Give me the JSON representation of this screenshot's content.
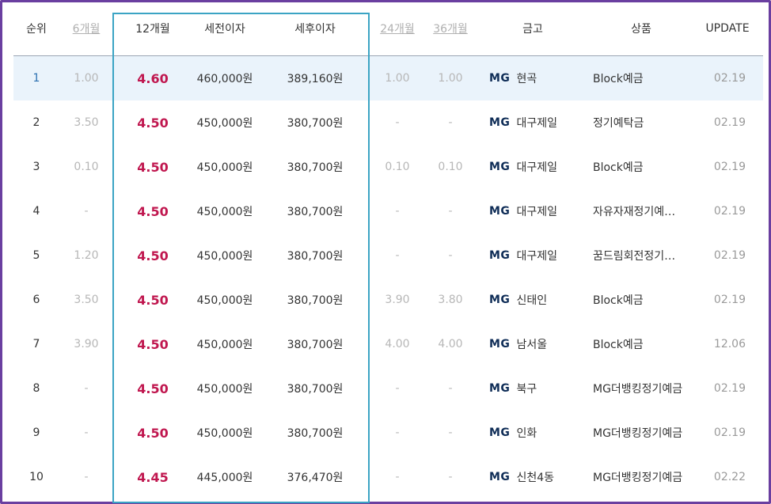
{
  "header": {
    "rank": "순위",
    "m6": "6개월",
    "m12": "12개월",
    "pretax": "세전이자",
    "posttax": "세후이자",
    "m24": "24개월",
    "m36": "36개월",
    "bank": "금고",
    "product": "상품",
    "update": "UPDATE"
  },
  "colors": {
    "frame": "#6a3fa0",
    "highlight_box": "#3ba4c4",
    "rate": "#c0174f",
    "first_row_bg": "#eaf3fb",
    "brand": "#0f2d57"
  },
  "brand_prefix": "MG",
  "rows": [
    {
      "rank": "1",
      "m6": "1.00",
      "m12": "4.60",
      "pretax": "460,000원",
      "posttax": "389,160원",
      "m24": "1.00",
      "m36": "1.00",
      "bank": "현곡",
      "product": "Block예금",
      "update": "02.19"
    },
    {
      "rank": "2",
      "m6": "3.50",
      "m12": "4.50",
      "pretax": "450,000원",
      "posttax": "380,700원",
      "m24": "-",
      "m36": "-",
      "bank": "대구제일",
      "product": "정기예탁금",
      "update": "02.19"
    },
    {
      "rank": "3",
      "m6": "0.10",
      "m12": "4.50",
      "pretax": "450,000원",
      "posttax": "380,700원",
      "m24": "0.10",
      "m36": "0.10",
      "bank": "대구제일",
      "product": "Block예금",
      "update": "02.19"
    },
    {
      "rank": "4",
      "m6": "-",
      "m12": "4.50",
      "pretax": "450,000원",
      "posttax": "380,700원",
      "m24": "-",
      "m36": "-",
      "bank": "대구제일",
      "product": "자유자재정기예…",
      "update": "02.19"
    },
    {
      "rank": "5",
      "m6": "1.20",
      "m12": "4.50",
      "pretax": "450,000원",
      "posttax": "380,700원",
      "m24": "-",
      "m36": "-",
      "bank": "대구제일",
      "product": "꿈드림회전정기…",
      "update": "02.19"
    },
    {
      "rank": "6",
      "m6": "3.50",
      "m12": "4.50",
      "pretax": "450,000원",
      "posttax": "380,700원",
      "m24": "3.90",
      "m36": "3.80",
      "bank": "신태인",
      "product": "Block예금",
      "update": "02.19"
    },
    {
      "rank": "7",
      "m6": "3.90",
      "m12": "4.50",
      "pretax": "450,000원",
      "posttax": "380,700원",
      "m24": "4.00",
      "m36": "4.00",
      "bank": "남서울",
      "product": "Block예금",
      "update": "12.06"
    },
    {
      "rank": "8",
      "m6": "-",
      "m12": "4.50",
      "pretax": "450,000원",
      "posttax": "380,700원",
      "m24": "-",
      "m36": "-",
      "bank": "북구",
      "product": "MG더뱅킹정기예금",
      "update": "02.19"
    },
    {
      "rank": "9",
      "m6": "-",
      "m12": "4.50",
      "pretax": "450,000원",
      "posttax": "380,700원",
      "m24": "-",
      "m36": "-",
      "bank": "인화",
      "product": "MG더뱅킹정기예금",
      "update": "02.19"
    },
    {
      "rank": "10",
      "m6": "-",
      "m12": "4.45",
      "pretax": "445,000원",
      "posttax": "376,470원",
      "m24": "-",
      "m36": "-",
      "bank": "신천4동",
      "product": "MG더뱅킹정기예금",
      "update": "02.22"
    }
  ]
}
